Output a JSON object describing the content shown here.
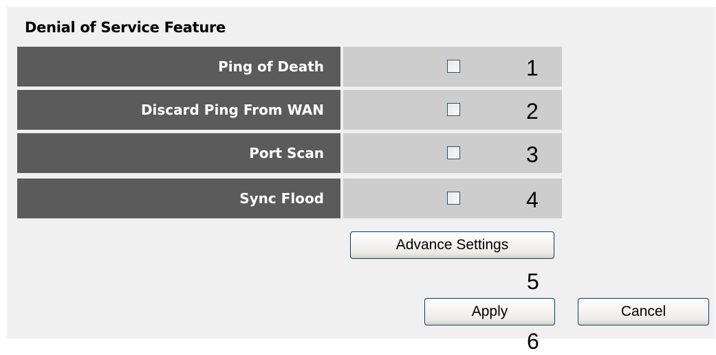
{
  "section_title": "Denial of Service Feature",
  "rows": [
    {
      "label": "Ping of Death",
      "checked": false,
      "marker": "1"
    },
    {
      "label": "Discard Ping From WAN",
      "checked": false,
      "marker": "2"
    },
    {
      "label": "Port Scan",
      "checked": false,
      "marker": "3"
    },
    {
      "label": "Sync Flood",
      "checked": false,
      "marker": "4"
    }
  ],
  "buttons": {
    "advance_settings": "Advance Settings",
    "apply": "Apply",
    "cancel": "Cancel"
  },
  "markers": {
    "advance": "5",
    "apply": "6"
  }
}
